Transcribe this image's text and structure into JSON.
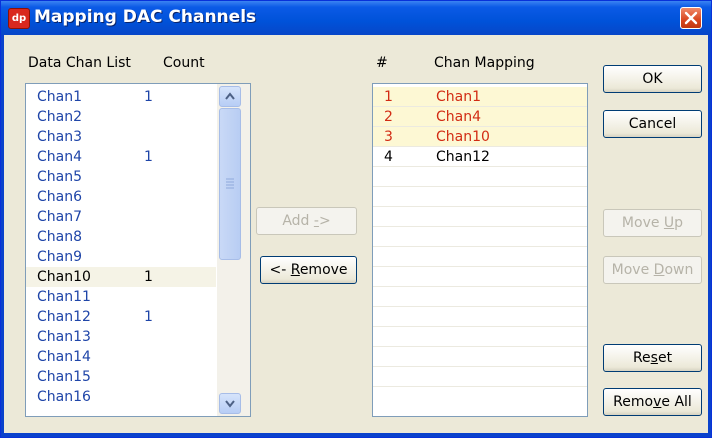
{
  "window": {
    "title": "Mapping DAC Channels",
    "app_icon_text": "dp"
  },
  "left_panel": {
    "header_list": "Data Chan List",
    "header_count": "Count",
    "rows": [
      {
        "name": "Chan1",
        "count": "1"
      },
      {
        "name": "Chan2",
        "count": ""
      },
      {
        "name": "Chan3",
        "count": ""
      },
      {
        "name": "Chan4",
        "count": "1"
      },
      {
        "name": "Chan5",
        "count": ""
      },
      {
        "name": "Chan6",
        "count": ""
      },
      {
        "name": "Chan7",
        "count": ""
      },
      {
        "name": "Chan8",
        "count": ""
      },
      {
        "name": "Chan9",
        "count": ""
      },
      {
        "name": "Chan10",
        "count": "1",
        "selected": true
      },
      {
        "name": "Chan11",
        "count": ""
      },
      {
        "name": "Chan12",
        "count": "1"
      },
      {
        "name": "Chan13",
        "count": ""
      },
      {
        "name": "Chan14",
        "count": ""
      },
      {
        "name": "Chan15",
        "count": ""
      },
      {
        "name": "Chan16",
        "count": ""
      }
    ]
  },
  "right_panel": {
    "header_num": "#",
    "header_mapping": "Chan Mapping",
    "rows": [
      {
        "num": "1",
        "chan": "Chan1",
        "highlighted": true
      },
      {
        "num": "2",
        "chan": "Chan4",
        "highlighted": true
      },
      {
        "num": "3",
        "chan": "Chan10",
        "highlighted": true
      },
      {
        "num": "4",
        "chan": "Chan12",
        "highlighted": false
      }
    ],
    "empty_row_count": 11
  },
  "buttons": {
    "add": {
      "pre": "Add ",
      "u": "-",
      "post": ">",
      "enabled": false
    },
    "remove": {
      "pre": "<- ",
      "u": "R",
      "post": "emove",
      "enabled": true
    },
    "ok": {
      "label": "OK"
    },
    "cancel": {
      "label": "Cancel"
    },
    "move_up": {
      "pre": "Move ",
      "u": "U",
      "post": "p",
      "enabled": false
    },
    "move_down": {
      "pre": "Move ",
      "u": "D",
      "post": "own",
      "enabled": false
    },
    "reset": {
      "pre": "Re",
      "u": "s",
      "post": "et"
    },
    "remove_all": {
      "pre": "Remo",
      "u": "v",
      "post": "e All"
    }
  },
  "colors": {
    "title_bar": "#0052d9",
    "list_text": "#1f45a8",
    "mapped_text": "#d22c14",
    "mapped_row_bg": "#fdf8d4",
    "dialog_bg": "#ece9d8"
  }
}
